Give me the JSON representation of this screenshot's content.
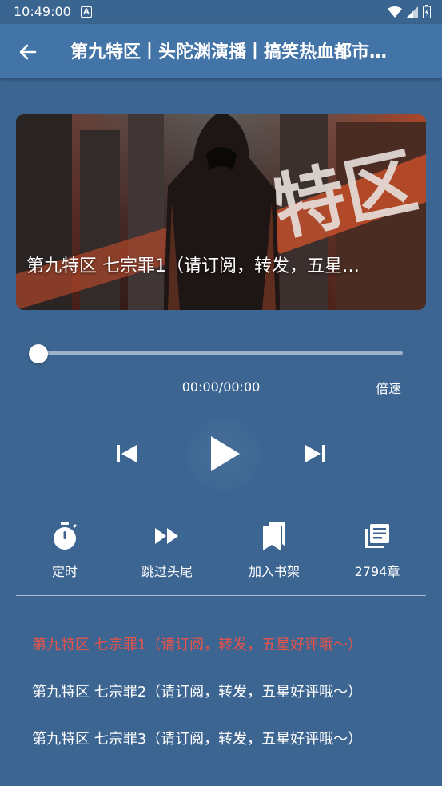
{
  "status": {
    "time": "10:49:00",
    "indicator": "A"
  },
  "appbar": {
    "title": "第九特区丨头陀渊演播丨搞笑热血都市…"
  },
  "cover": {
    "title": "第九特区 七宗罪1（请订阅，转发，五星…",
    "art_text": "特区"
  },
  "player": {
    "time": "00:00/00:00",
    "speed_label": "倍速",
    "progress": 0
  },
  "tools": {
    "timer": "定时",
    "skip": "跳过头尾",
    "shelf": "加入书架",
    "chapters": "2794章"
  },
  "chapters": [
    {
      "label": "第九特区 七宗罪1（请订阅，转发，五星好评哦～）",
      "active": true
    },
    {
      "label": "第九特区 七宗罪2（请订阅，转发，五星好评哦～）",
      "active": false
    },
    {
      "label": "第九特区 七宗罪3（请订阅，转发，五星好评哦～）",
      "active": false
    }
  ],
  "colors": {
    "background": "#3c6592",
    "appbar": "#4274a7",
    "active_chapter": "#e5534b"
  }
}
